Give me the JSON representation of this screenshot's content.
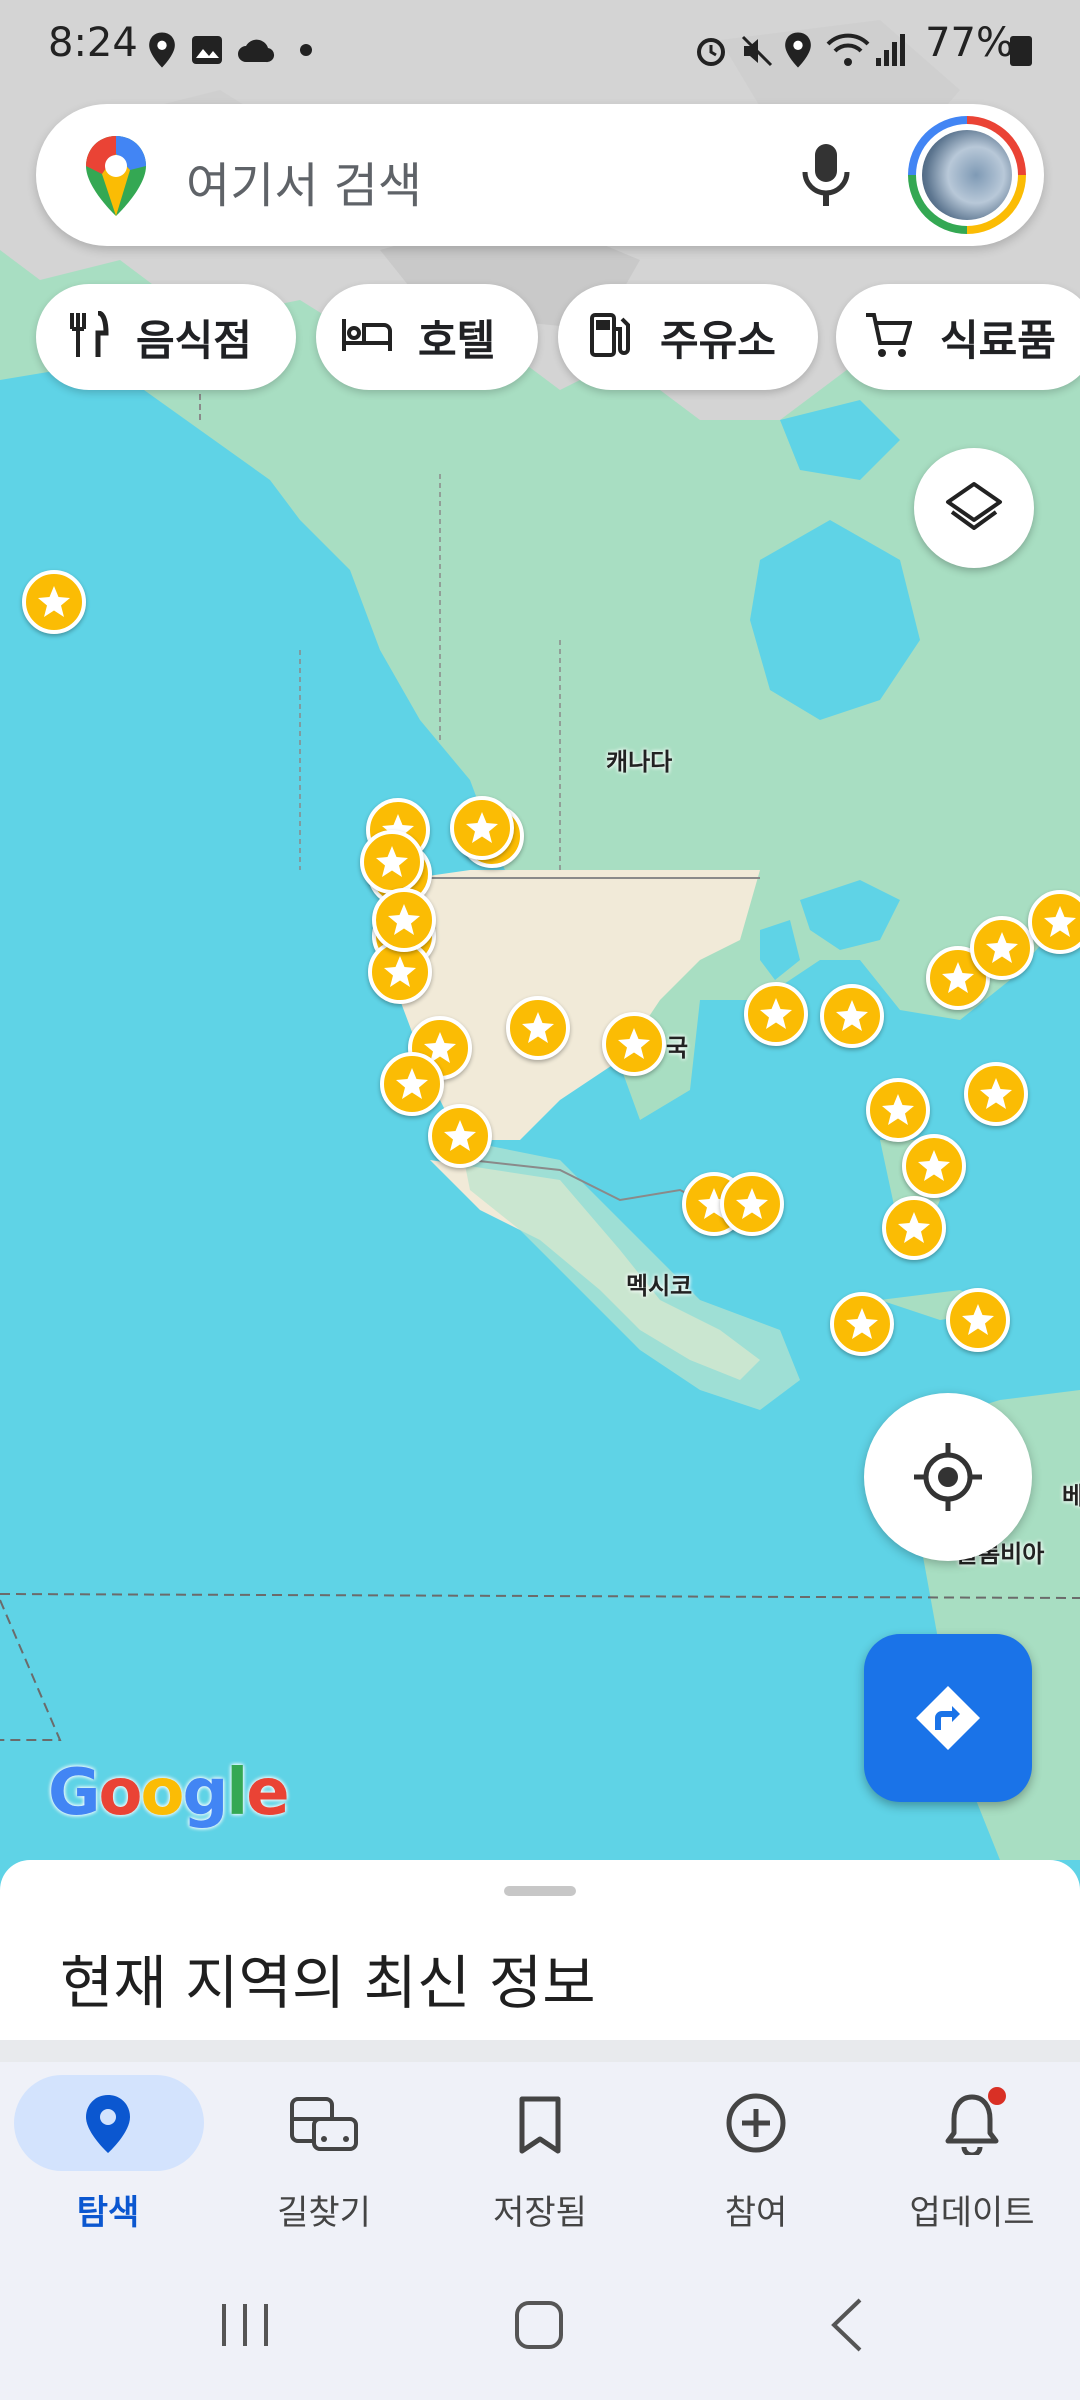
{
  "status_bar": {
    "time": "8:24",
    "battery": "77%",
    "icons": [
      "location-icon",
      "image-icon",
      "cloud-sync-icon",
      "dot-icon",
      "alarm-icon",
      "mute-icon",
      "location-icon",
      "wifi-icon",
      "signal-icon",
      "battery-icon"
    ]
  },
  "search": {
    "placeholder": "여기서 검색",
    "left_icon": "maps-pin-logo",
    "mic_icon": "mic-icon",
    "avatar_icon": "avatar"
  },
  "chips": [
    {
      "label": "음식점",
      "icon": "restaurant-icon"
    },
    {
      "label": "호텔",
      "icon": "hotel-icon"
    },
    {
      "label": "주유소",
      "icon": "gas-station-icon"
    },
    {
      "label": "식료품",
      "icon": "cart-icon"
    }
  ],
  "map": {
    "labels": {
      "canada": "캐나다",
      "usa": "국",
      "mexico": "멕시코",
      "colombia": "콜롬비아",
      "partial_right": "베"
    },
    "starred_places_count": 27,
    "watermark": "Google",
    "colors": {
      "water": "#5fd3e6",
      "land_green": "#a8dec2",
      "land_beige": "#f1ead8",
      "land_gray": "#d6d6d6",
      "star": "#fbbc04"
    }
  },
  "buttons": {
    "layers": "layers-icon",
    "my_location": "my-location-icon",
    "directions": "directions-icon"
  },
  "sheet": {
    "title": "현재 지역의 최신 정보"
  },
  "nav": {
    "items": [
      {
        "label": "탐색",
        "icon": "explore-pin-icon",
        "active": true
      },
      {
        "label": "길찾기",
        "icon": "commute-icon",
        "active": false
      },
      {
        "label": "저장됨",
        "icon": "bookmark-icon",
        "active": false
      },
      {
        "label": "참여",
        "icon": "add-circle-icon",
        "active": false
      },
      {
        "label": "업데이트",
        "icon": "bell-icon",
        "active": false,
        "badge": true
      }
    ]
  },
  "system_nav": [
    "recents-icon",
    "home-icon",
    "back-icon"
  ]
}
